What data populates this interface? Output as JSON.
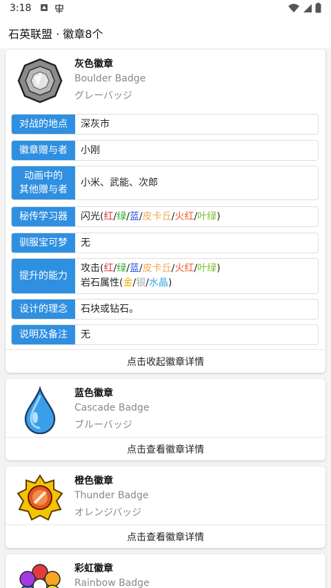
{
  "status_bar": {
    "time": "3:18",
    "left_icons": [
      "news-icon",
      "sim-app-icon"
    ],
    "right_icons": [
      "wifi-icon",
      "signal-icon",
      "battery-icon"
    ]
  },
  "app_bar": {
    "title": "石英联盟 · 徽章8个"
  },
  "badges": [
    {
      "name": "灰色徽章",
      "english": "Boulder Badge",
      "japanese": "グレーバッジ",
      "icon": "boulder-badge-icon",
      "toggle_label": "点击收起徽章详情",
      "details": [
        {
          "label": "对战的地点",
          "value": "深灰市"
        },
        {
          "label": "徽章赠与者",
          "value": "小刚"
        },
        {
          "label": "动画中的其他赠与者",
          "label_lines": [
            "动画中的",
            "其他赠与者"
          ],
          "value": "小米、武能、次郎"
        },
        {
          "label": "秘传学习器",
          "value": "闪光(红/绿/蓝/皮卡丘/火红/叶绿)",
          "value_prefix": "闪光(",
          "versions": [
            "红",
            "绿",
            "蓝",
            "皮卡丘",
            "火红",
            "叶绿"
          ],
          "value_suffix": ")"
        },
        {
          "label": "驯服宝可梦",
          "value": "无"
        },
        {
          "label": "提升的能力",
          "line1_prefix": "攻击(",
          "line1_versions": [
            "红",
            "绿",
            "蓝",
            "皮卡丘",
            "火红",
            "叶绿"
          ],
          "line1_suffix": ")",
          "line2_prefix": "岩石属性(",
          "line2_versions": [
            "金",
            "银",
            "水晶"
          ],
          "line2_suffix": ")"
        },
        {
          "label": "设计的理念",
          "value": "石块或钻石。"
        },
        {
          "label": "说明及备注",
          "value": "无"
        }
      ]
    },
    {
      "name": "蓝色徽章",
      "english": "Cascade Badge",
      "japanese": "ブルーバッジ",
      "icon": "cascade-badge-icon",
      "toggle_label": "点击查看徽章详情"
    },
    {
      "name": "橙色徽章",
      "english": "Thunder Badge",
      "japanese": "オレンジバッジ",
      "icon": "thunder-badge-icon",
      "toggle_label": "点击查看徽章详情"
    },
    {
      "name": "彩虹徽章",
      "english": "Rainbow Badge",
      "japanese": "",
      "icon": "rainbow-badge-icon"
    }
  ],
  "colors": {
    "label_bg": "#2f8fe0",
    "version_red": "#e03030",
    "version_green": "#33aa33",
    "version_blue": "#2255dd",
    "version_pikachu": "#f0a75a",
    "version_firered": "#f05a28",
    "version_leafgreen": "#7bbf2a",
    "version_gold": "#e8b000",
    "version_silver": "#aaaaaa",
    "version_crystal": "#35a9e8"
  }
}
